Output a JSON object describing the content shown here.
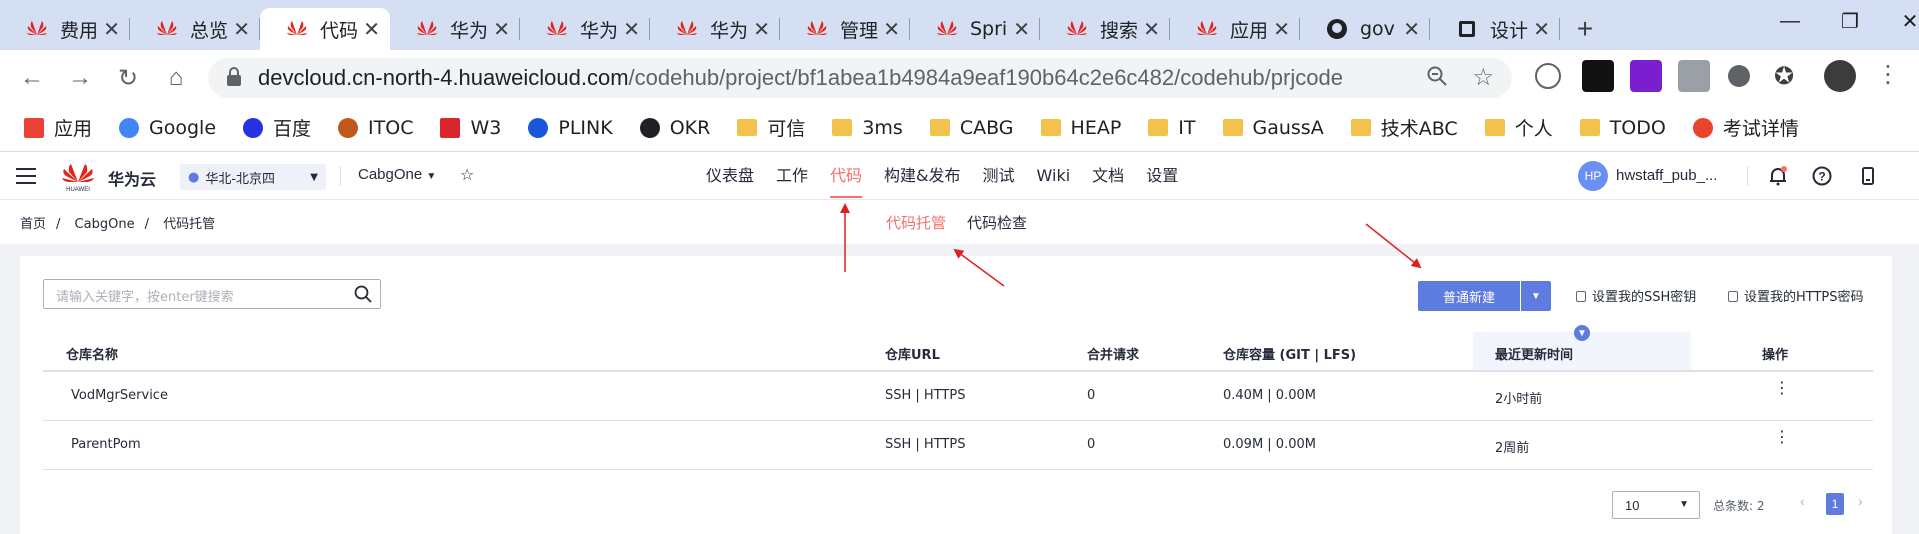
{
  "browser": {
    "tabs": [
      {
        "title": "费用",
        "icon": "huawei-icon",
        "active": false
      },
      {
        "title": "总览",
        "icon": "huawei-icon",
        "active": false
      },
      {
        "title": "代码",
        "icon": "huawei-icon",
        "active": true
      },
      {
        "title": "华为",
        "icon": "huawei-icon",
        "active": false
      },
      {
        "title": "华为",
        "icon": "huawei-icon",
        "active": false
      },
      {
        "title": "华为",
        "icon": "huawei-icon",
        "active": false
      },
      {
        "title": "管理",
        "icon": "huawei-icon",
        "active": false
      },
      {
        "title": "Spri",
        "icon": "huawei-icon",
        "active": false
      },
      {
        "title": "搜索",
        "icon": "huawei-icon",
        "active": false
      },
      {
        "title": "应用",
        "icon": "huawei-icon",
        "active": false
      },
      {
        "title": "gov",
        "icon": "github-icon",
        "active": false
      },
      {
        "title": "设计",
        "icon": "book-icon",
        "active": false
      }
    ],
    "url_host": "devcloud.cn-north-4.huaweicloud.com",
    "url_path": "/codehub/project/bf1abea1b4984a9eaf190b64c2e6c482/codehub/prjcode",
    "bookmarks": [
      {
        "label": "应用",
        "icon": "apps-grid-icon"
      },
      {
        "label": "Google",
        "icon": "google-icon"
      },
      {
        "label": "百度",
        "icon": "baidu-icon"
      },
      {
        "label": "ITOC",
        "icon": "itoc-icon"
      },
      {
        "label": "W3",
        "icon": "w3-icon"
      },
      {
        "label": "PLINK",
        "icon": "plink-icon"
      },
      {
        "label": "OKR",
        "icon": "globe-icon"
      },
      {
        "label": "可信",
        "icon": "folder-icon"
      },
      {
        "label": "3ms",
        "icon": "folder-icon"
      },
      {
        "label": "CABG",
        "icon": "folder-icon"
      },
      {
        "label": "HEAP",
        "icon": "folder-icon"
      },
      {
        "label": "IT",
        "icon": "folder-icon"
      },
      {
        "label": "GaussA",
        "icon": "folder-icon"
      },
      {
        "label": "技术ABC",
        "icon": "folder-icon"
      },
      {
        "label": "个人",
        "icon": "folder-icon"
      },
      {
        "label": "TODO",
        "icon": "folder-icon"
      },
      {
        "label": "考试详情",
        "icon": "exam-icon"
      }
    ]
  },
  "app": {
    "brand": "华为云",
    "region": "华北-北京四",
    "project": "CabgOne",
    "nav": [
      "仪表盘",
      "工作",
      "代码",
      "构建&发布",
      "测试",
      "Wiki",
      "文档",
      "设置"
    ],
    "nav_active": "代码",
    "avatar_initials": "HP",
    "username": "hwstaff_pub_..."
  },
  "breadcrumb": [
    "首页",
    "CabgOne",
    "代码托管"
  ],
  "subtabs": [
    "代码托管",
    "代码检查"
  ],
  "toolbar": {
    "search_placeholder": "请输入关键字，按enter键搜索",
    "new_button": "普通新建",
    "ssh_link": "设置我的SSH密钥",
    "https_link": "设置我的HTTPS密码"
  },
  "table": {
    "headers": [
      "仓库名称",
      "仓库URL",
      "合并请求",
      "仓库容量 (GIT | LFS)",
      "最近更新时间",
      "操作"
    ],
    "rows": [
      {
        "name": "VodMgrService",
        "url": "SSH | HTTPS",
        "mr": "0",
        "capacity": "0.40M  |  0.00M",
        "updated": "2小时前"
      },
      {
        "name": "ParentPom",
        "url": "SSH | HTTPS",
        "mr": "0",
        "capacity": "0.09M  |  0.00M",
        "updated": "2周前"
      }
    ]
  },
  "pager": {
    "page_size": "10",
    "total": "总条数: 2",
    "current": "1"
  },
  "colors": {
    "accent": "#5e7ce0",
    "active_nav": "#f66f6a",
    "annotation_arrow": "#e02020"
  }
}
